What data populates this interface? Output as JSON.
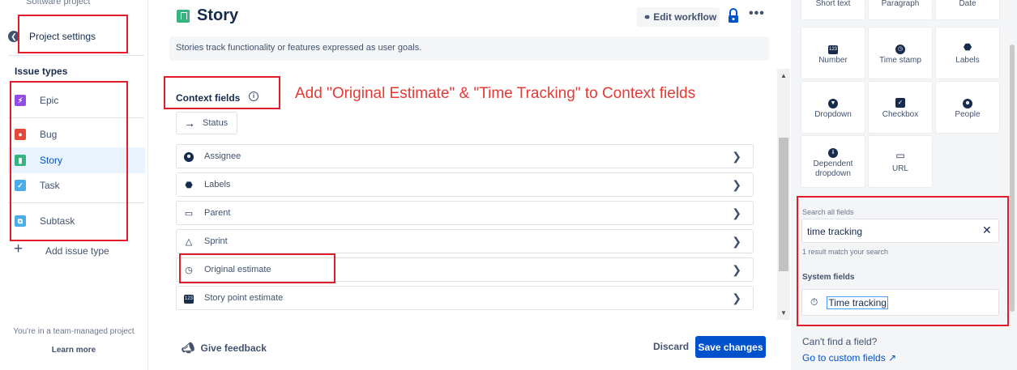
{
  "sidebar": {
    "project_subtitle": "Software project",
    "back_label": "Project settings",
    "issue_types_heading": "Issue types",
    "items": [
      {
        "label": "Epic",
        "color": "#904ee2"
      },
      {
        "label": "Bug",
        "color": "#e5493a"
      },
      {
        "label": "Story",
        "color": "#36b37e"
      },
      {
        "label": "Task",
        "color": "#4bade8"
      },
      {
        "label": "Subtask",
        "color": "#4bade8"
      }
    ],
    "active_item": "Story",
    "add_issue_type": "Add issue type",
    "managed_note": "You're in a team-managed project",
    "learn_more": "Learn more"
  },
  "header": {
    "title": "Story",
    "edit_workflow": "Edit workflow",
    "more": "•••",
    "description": "Stories track functionality or features expressed as user goals."
  },
  "context": {
    "label": "Context fields",
    "annotation": "Add \"Original Estimate\" & \"Time Tracking\" to Context fields",
    "status_chip": "Status",
    "fields": [
      {
        "label": "Assignee",
        "icon": "person-icon"
      },
      {
        "label": "Labels",
        "icon": "tag-icon"
      },
      {
        "label": "Parent",
        "icon": "parent-icon"
      },
      {
        "label": "Sprint",
        "icon": "sprint-icon"
      },
      {
        "label": "Original estimate",
        "icon": "clock-icon"
      },
      {
        "label": "Story point estimate",
        "icon": "number-icon"
      }
    ]
  },
  "footer": {
    "feedback": "Give feedback",
    "discard": "Discard",
    "save": "Save changes"
  },
  "field_palette": {
    "top_row": [
      "Short text",
      "Paragraph",
      "Date"
    ],
    "tiles": [
      {
        "label": "Number",
        "icon": "number-icon"
      },
      {
        "label": "Time stamp",
        "icon": "clock-icon"
      },
      {
        "label": "Labels",
        "icon": "tag-icon"
      },
      {
        "label": "Dropdown",
        "icon": "dropdown-icon"
      },
      {
        "label": "Checkbox",
        "icon": "checkbox-icon"
      },
      {
        "label": "People",
        "icon": "person-icon"
      },
      {
        "label": "Dependent dropdown",
        "icon": "dependent-dropdown-icon"
      },
      {
        "label": "URL",
        "icon": "link-icon"
      }
    ],
    "search_label": "Search all fields",
    "search_value": "time tracking",
    "result_count": "1 result match your search",
    "system_fields_label": "System fields",
    "result_item": "Time tracking",
    "cant_find": "Can't find a field?",
    "custom_link": "Go to custom fields"
  }
}
